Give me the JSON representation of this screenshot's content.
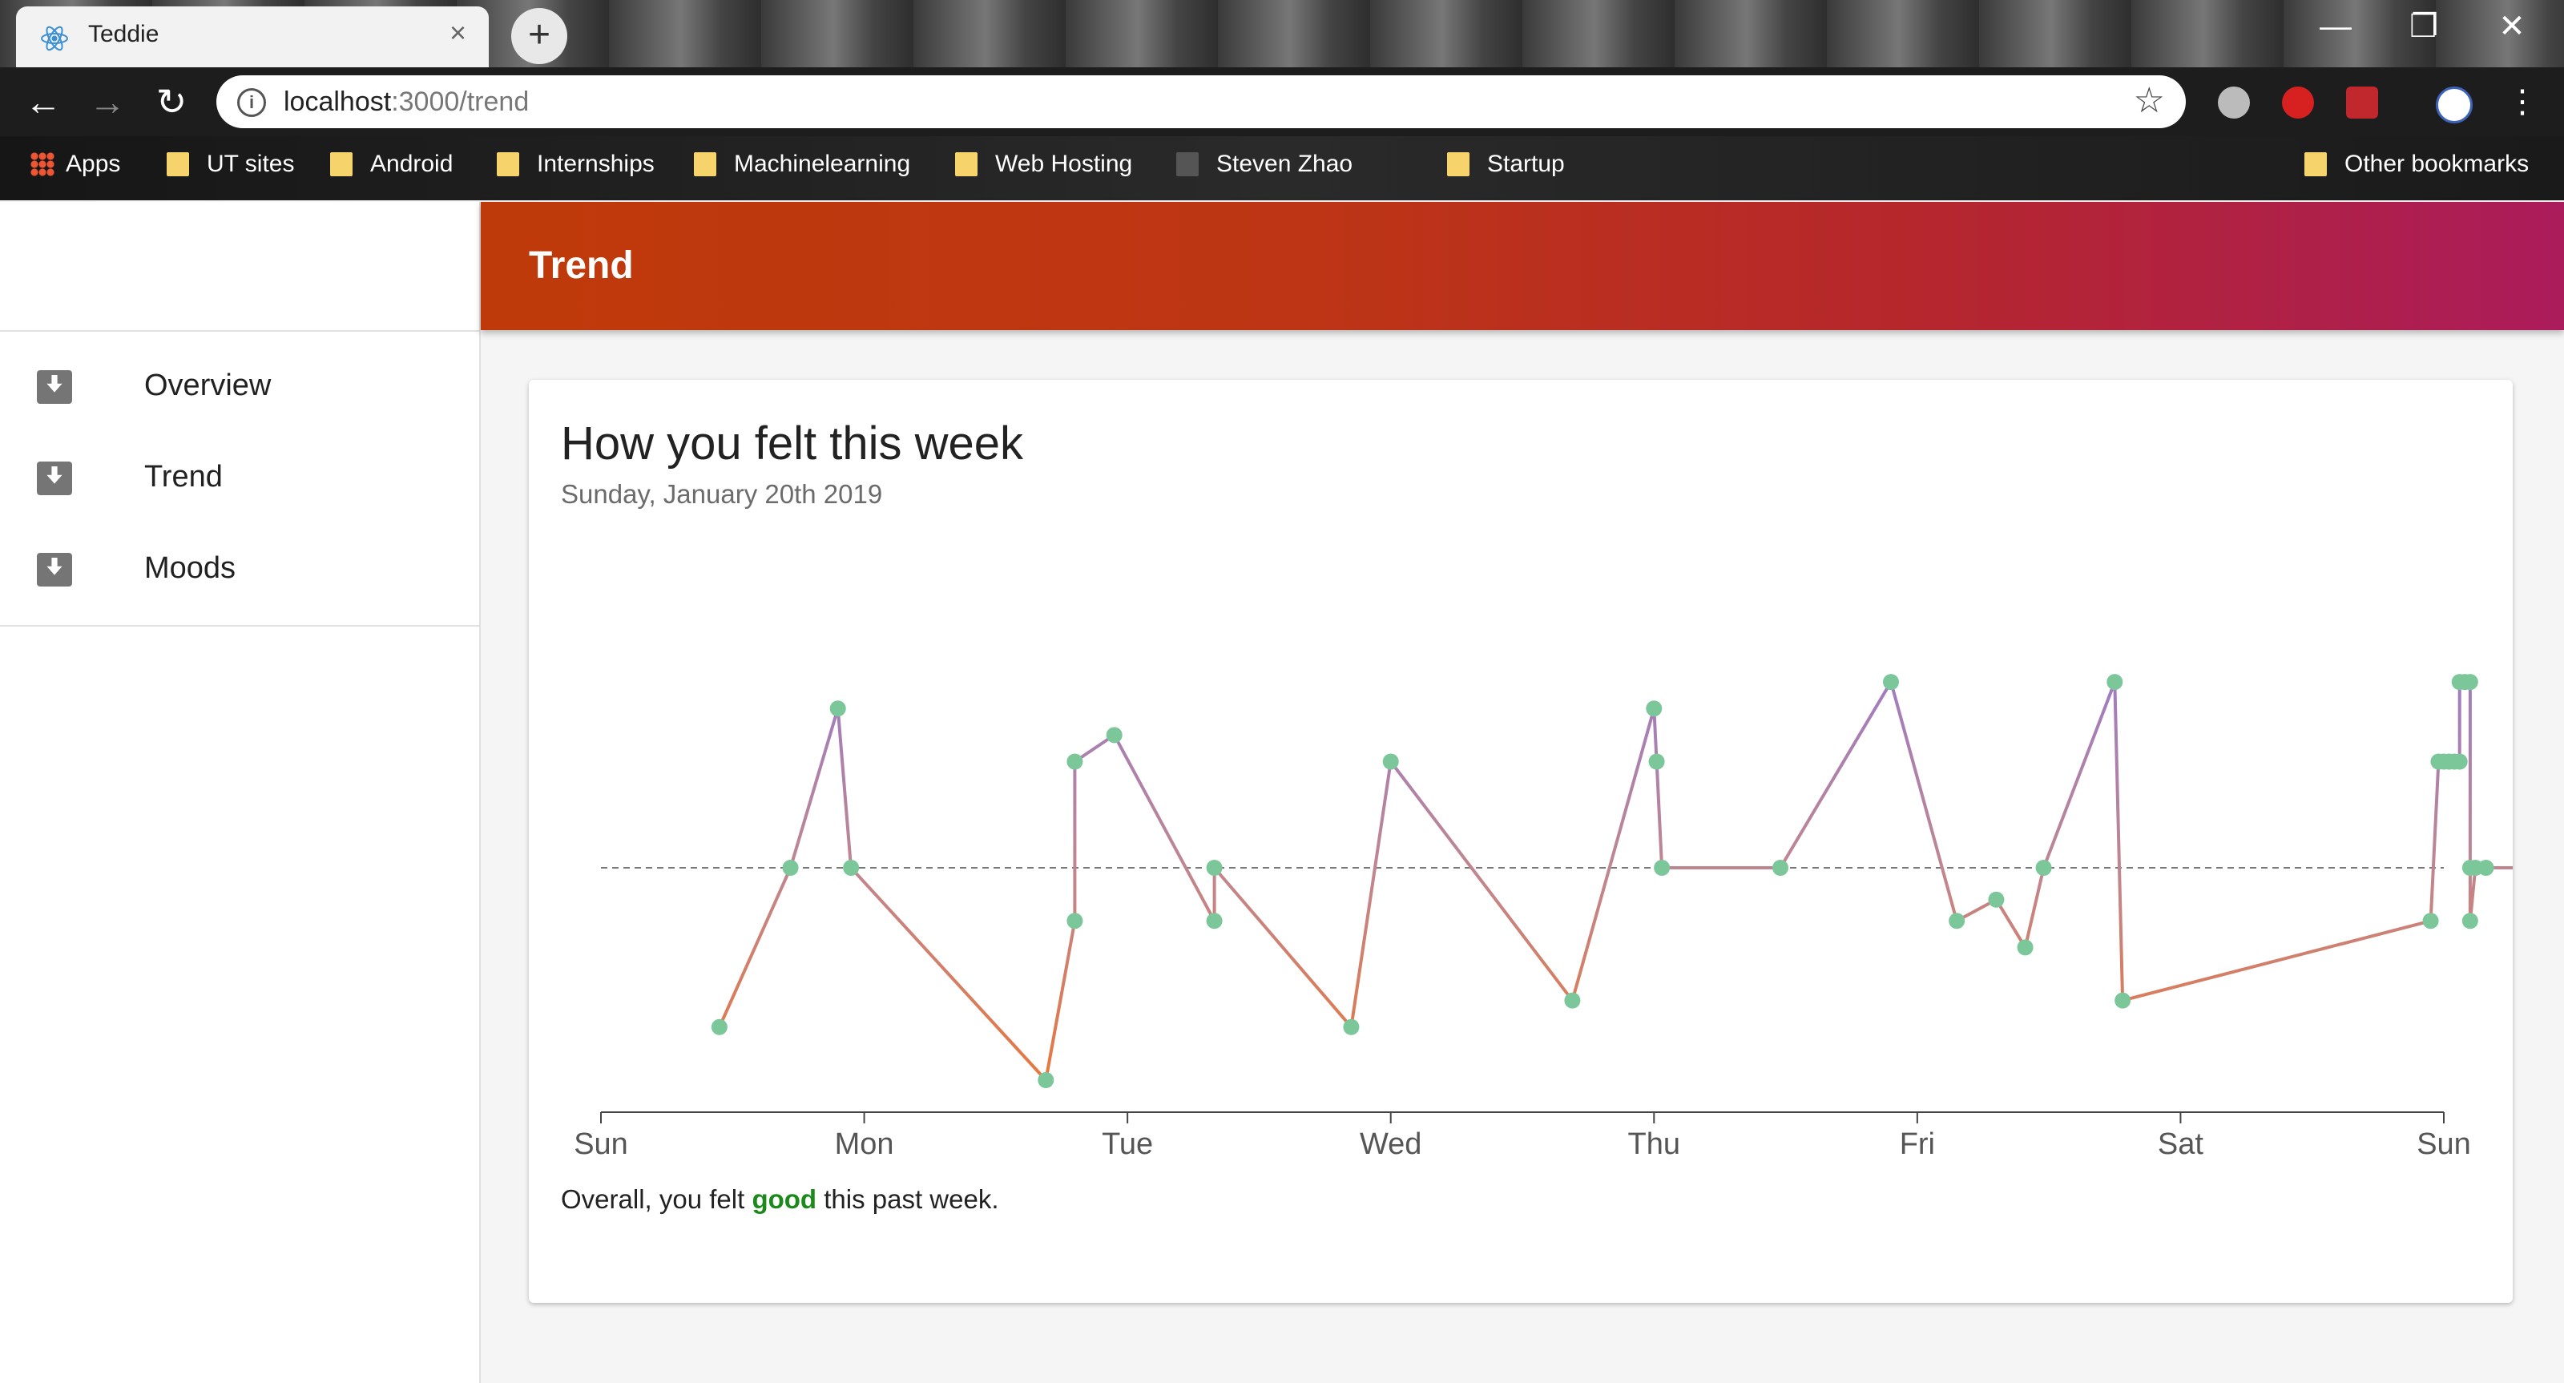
{
  "browser": {
    "tab_title": "Teddie",
    "tab_close": "×",
    "new_tab": "+",
    "url_host": "localhost",
    "url_path": ":3000/trend",
    "window_controls": {
      "minimize": "—",
      "restore": "❐",
      "close": "✕"
    },
    "bookmarks": [
      "Apps",
      "UT sites",
      "Android",
      "Internships",
      "Machinelearning",
      "Web Hosting",
      "Steven Zhao",
      "Startup",
      "Other bookmarks"
    ]
  },
  "app": {
    "header_title": "Trend",
    "nav": [
      {
        "label": "Overview",
        "icon": "inbox-download-icon"
      },
      {
        "label": "Trend",
        "icon": "inbox-download-icon"
      },
      {
        "label": "Moods",
        "icon": "inbox-download-icon"
      }
    ]
  },
  "card": {
    "title": "How you felt this week",
    "subtitle": "Sunday, January 20th 2019",
    "summary_prefix": "Overall, you felt ",
    "summary_word": "good",
    "summary_suffix": " this past week."
  },
  "chart_data": {
    "type": "line",
    "x_unit": "day of week",
    "x_ticks": [
      "Sun",
      "Mon",
      "Tue",
      "Wed",
      "Thu",
      "Fri",
      "Sat",
      "Sun"
    ],
    "xlim": [
      0,
      7
    ],
    "ylim": [
      -4,
      4
    ],
    "baseline": 0,
    "grid": false,
    "colors": {
      "high": "#9b7bc8",
      "low": "#e8773c",
      "point": "#7cc79a",
      "baseline": "#777777"
    },
    "points": [
      [
        0.45,
        -3
      ],
      [
        0.72,
        0
      ],
      [
        0.9,
        3
      ],
      [
        0.95,
        0
      ],
      [
        1.69,
        -4
      ],
      [
        1.8,
        -1
      ],
      [
        1.8,
        2
      ],
      [
        1.95,
        2.5
      ],
      [
        2.33,
        -1
      ],
      [
        2.33,
        0
      ],
      [
        2.85,
        -3
      ],
      [
        3.0,
        2
      ],
      [
        3.69,
        -2.5
      ],
      [
        4.0,
        3
      ],
      [
        4.01,
        2
      ],
      [
        4.03,
        0
      ],
      [
        4.48,
        0
      ],
      [
        4.9,
        3.5
      ],
      [
        5.15,
        -1
      ],
      [
        5.3,
        -0.6
      ],
      [
        5.41,
        -1.5
      ],
      [
        5.48,
        0
      ],
      [
        5.75,
        3.5
      ],
      [
        5.78,
        -2.5
      ],
      [
        6.95,
        -1
      ],
      [
        6.98,
        2
      ],
      [
        7.0,
        2
      ],
      [
        7.02,
        2
      ],
      [
        7.04,
        2
      ],
      [
        7.06,
        2
      ],
      [
        7.06,
        3.5
      ],
      [
        7.08,
        3.5
      ],
      [
        7.1,
        3.5
      ],
      [
        7.1,
        0
      ],
      [
        7.1,
        -1
      ],
      [
        7.12,
        0
      ],
      [
        7.16,
        0
      ],
      [
        7.68,
        0
      ]
    ]
  }
}
